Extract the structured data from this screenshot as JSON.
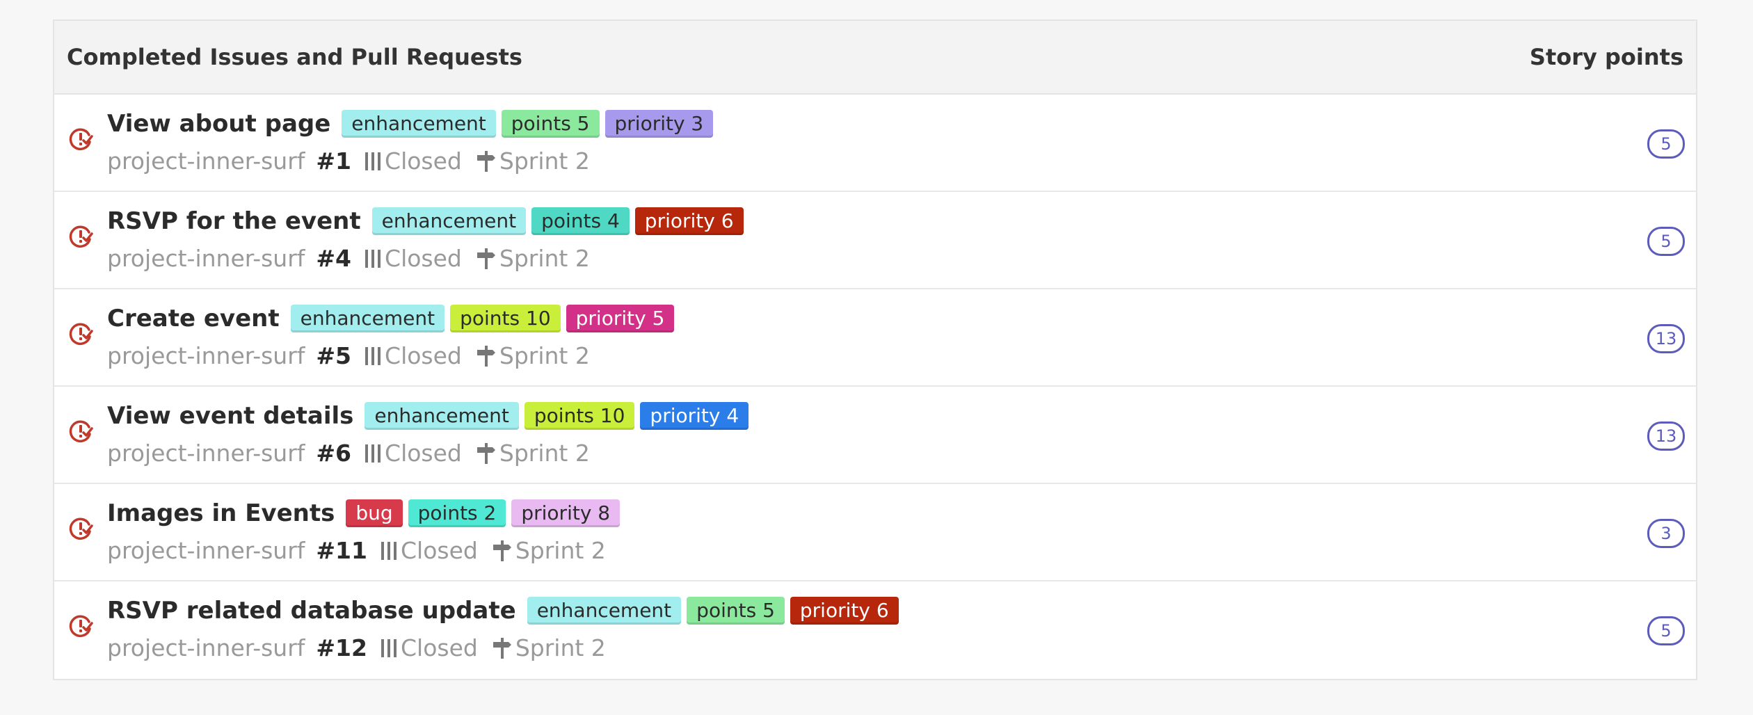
{
  "header": {
    "title": "Completed Issues and Pull Requests",
    "points_title": "Story points"
  },
  "issues": [
    {
      "title": "View about page",
      "labels": [
        {
          "text": "enhancement",
          "bg": "#a2eeef",
          "fg": "#2b2b2b"
        },
        {
          "text": "points 5",
          "bg": "#8ae99c",
          "fg": "#2b2b2b"
        },
        {
          "text": "priority 3",
          "bg": "#a79aed",
          "fg": "#2b2b2b"
        }
      ],
      "repo": "project-inner-surf",
      "number": "#1",
      "status": "Closed",
      "sprint": "Sprint 2",
      "points": "5"
    },
    {
      "title": "RSVP for the event",
      "labels": [
        {
          "text": "enhancement",
          "bg": "#a2eeef",
          "fg": "#2b2b2b"
        },
        {
          "text": "points 4",
          "bg": "#4fd8c4",
          "fg": "#2b2b2b"
        },
        {
          "text": "priority 6",
          "bg": "#b6270b",
          "fg": "#ffffff"
        }
      ],
      "repo": "project-inner-surf",
      "number": "#4",
      "status": "Closed",
      "sprint": "Sprint 2",
      "points": "5"
    },
    {
      "title": "Create event",
      "labels": [
        {
          "text": "enhancement",
          "bg": "#a2eeef",
          "fg": "#2b2b2b"
        },
        {
          "text": "points 10",
          "bg": "#c9ef3a",
          "fg": "#2b2b2b"
        },
        {
          "text": "priority 5",
          "bg": "#d33088",
          "fg": "#ffffff"
        }
      ],
      "repo": "project-inner-surf",
      "number": "#5",
      "status": "Closed",
      "sprint": "Sprint 2",
      "points": "13"
    },
    {
      "title": "View event details",
      "labels": [
        {
          "text": "enhancement",
          "bg": "#a2eeef",
          "fg": "#2b2b2b"
        },
        {
          "text": "points 10",
          "bg": "#c9ef3a",
          "fg": "#2b2b2b"
        },
        {
          "text": "priority 4",
          "bg": "#2b7de9",
          "fg": "#ffffff"
        }
      ],
      "repo": "project-inner-surf",
      "number": "#6",
      "status": "Closed",
      "sprint": "Sprint 2",
      "points": "13"
    },
    {
      "title": "Images in Events",
      "labels": [
        {
          "text": "bug",
          "bg": "#d73a4a",
          "fg": "#ffffff"
        },
        {
          "text": "points 2",
          "bg": "#4fe8d4",
          "fg": "#2b2b2b"
        },
        {
          "text": "priority 8",
          "bg": "#e9b9f2",
          "fg": "#2b2b2b"
        }
      ],
      "repo": "project-inner-surf",
      "number": "#11",
      "status": "Closed",
      "sprint": "Sprint 2",
      "points": "3"
    },
    {
      "title": "RSVP related database update",
      "labels": [
        {
          "text": "enhancement",
          "bg": "#a2eeef",
          "fg": "#2b2b2b"
        },
        {
          "text": "points 5",
          "bg": "#8ae99c",
          "fg": "#2b2b2b"
        },
        {
          "text": "priority 6",
          "bg": "#b6270b",
          "fg": "#ffffff"
        }
      ],
      "repo": "project-inner-surf",
      "number": "#12",
      "status": "Closed",
      "sprint": "Sprint 2",
      "points": "5"
    }
  ],
  "icons": {
    "issue": "issue-closed-icon",
    "status": "project-board-icon",
    "sprint": "milestone-icon"
  },
  "colors": {
    "issue_icon": "#c0392b",
    "points_badge": "#5c5cbd"
  }
}
